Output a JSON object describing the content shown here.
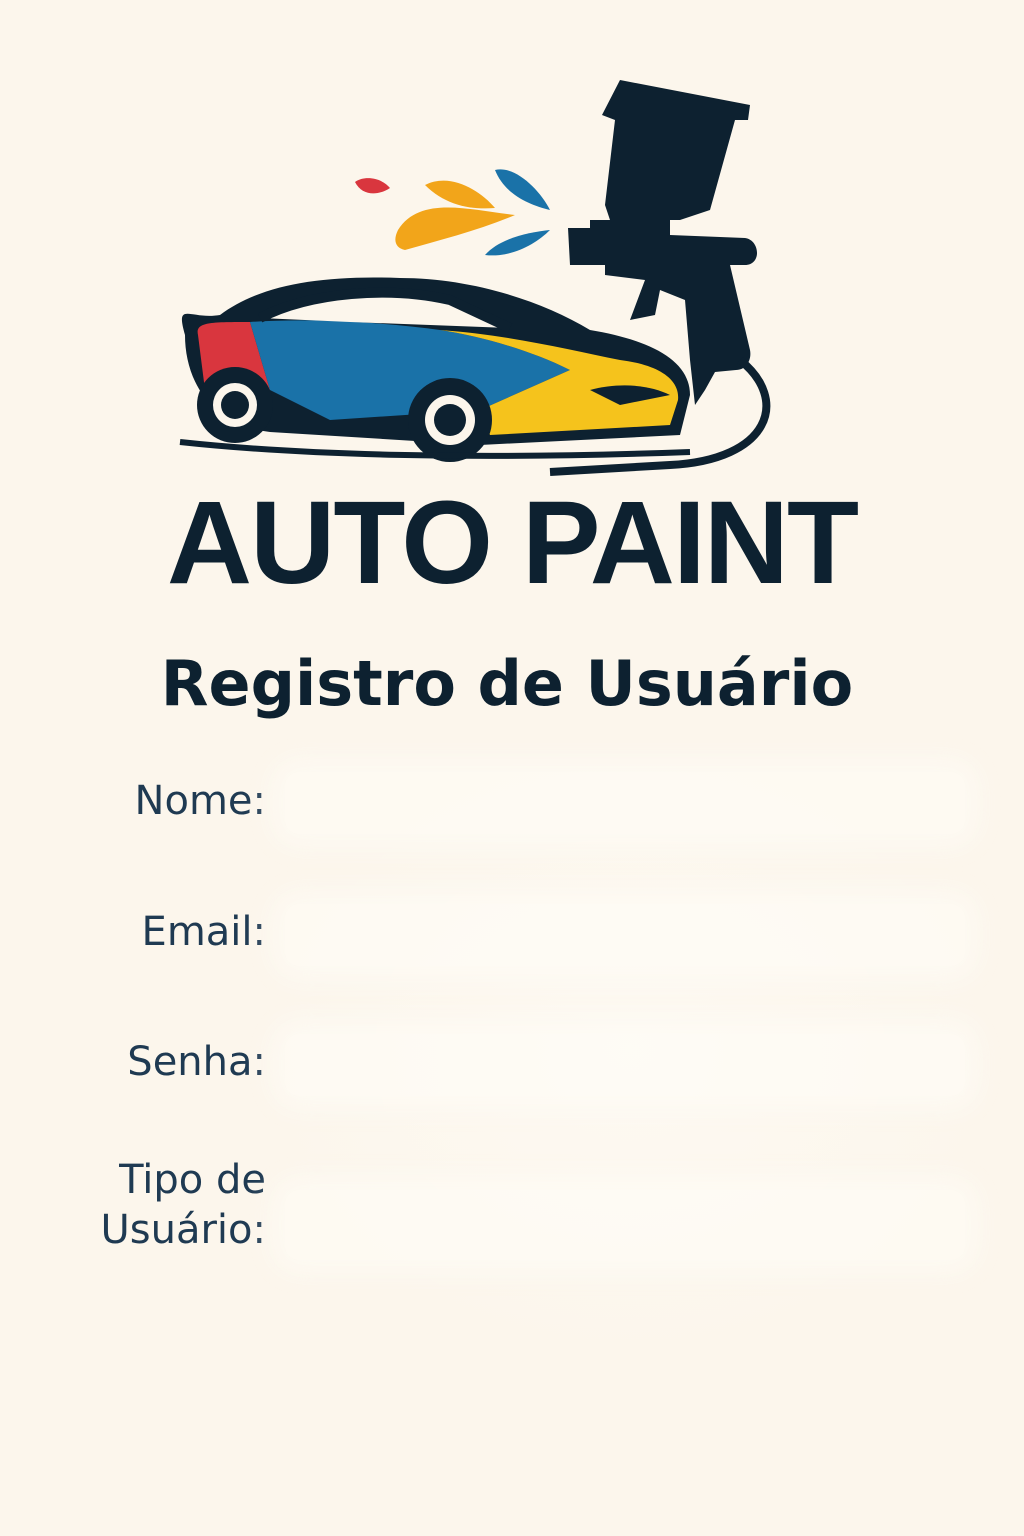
{
  "brand": {
    "name": "AUTO PAINT",
    "logo_icon": "car-spray-gun-logo"
  },
  "form": {
    "title": "Registro de Usuário",
    "fields": {
      "nome": {
        "label": "Nome:",
        "value": ""
      },
      "email": {
        "label": "Email:",
        "value": ""
      },
      "senha": {
        "label": "Senha:",
        "value": ""
      },
      "tipo": {
        "label_line1": "Tipo de",
        "label_line2": "Usuário:",
        "value": ""
      }
    }
  },
  "colors": {
    "background": "#fcf6ec",
    "text_dark": "#0d2130",
    "label": "#1f3a52",
    "paint_red": "#d9363e",
    "paint_blue": "#1a72a8",
    "paint_yellow": "#f5c31c",
    "paint_orange": "#f2a51a"
  }
}
